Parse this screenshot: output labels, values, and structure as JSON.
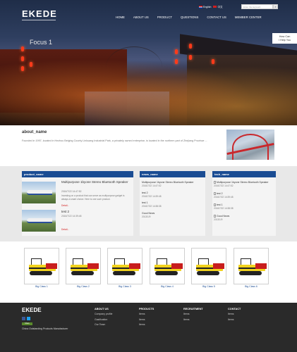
{
  "header": {
    "logo": "EKEDE",
    "lang_en": "English",
    "lang_cn": "中文",
    "search_placeholder": "Enter the keyword",
    "search_button": "⌕",
    "nav": [
      "HOME",
      "ABOUT US",
      "PRODUCT",
      "QUESTIONS",
      "CONTACT US",
      "MEMBER CENTER"
    ]
  },
  "hero": {
    "slide_label": "Focus 1",
    "help_line1": "How Can",
    "help_line2": "I Help You"
  },
  "about": {
    "title": "about_name",
    "text": "Founded in 1997, located in Hezhou Beiging County Linkuang Industrial Park, a privately owned enterprise, is located in the northern part of Zhejiang Province ..."
  },
  "products": {
    "head": "product_name",
    "items": [
      {
        "title": "Multipurpose 1byone Stereo Bluetooth Speaker",
        "date": "2016/7/22 14:47:52",
        "desc": "Investing on a product that can serve as multipurpose gadget is always a smart choice. Here is one such product.",
        "more": "Detail..."
      },
      {
        "title": "test 2",
        "date": "2016/7/22 14:39:48",
        "desc": "",
        "more": "Detail..."
      }
    ]
  },
  "news": {
    "head": "news_name",
    "items": [
      {
        "title": "Multipurpose 1byone Stereo Bluetooth Speaker",
        "date": "2016/7/22 14:47:52"
      },
      {
        "title": "test 2",
        "date": "2016/7/22 14:39:48"
      },
      {
        "title": "test 1",
        "date": "2016/7/22 14:38:38"
      },
      {
        "title": "Good News",
        "date": "2013/1/9"
      }
    ]
  },
  "tech": {
    "head": "tech_name",
    "items": [
      {
        "title": "Multipurpose 1byone Stereo Bluetooth Speaker",
        "date": "2016/7/22 14:47:52"
      },
      {
        "title": "test 2",
        "date": "2016/7/22 14:39:48"
      },
      {
        "title": "test 1",
        "date": "2016/7/22 14:38:38"
      },
      {
        "title": "Good News",
        "date": "2013/1/9"
      }
    ]
  },
  "gallery": [
    "Big Class 1",
    "Big Class 2",
    "Big Class 3",
    "Big Class 4",
    "Big Class 5",
    "Big Class 6"
  ],
  "footer": {
    "logo": "EKEDE",
    "share": "Share",
    "slogan": "China Outstanding Products Manufacturer",
    "cols": [
      {
        "head": "ABOUT US",
        "links": [
          "Company profile",
          "Gasification",
          "Our Team"
        ]
      },
      {
        "head": "PRODUCTS",
        "links": [
          "Items",
          "Items",
          "Items"
        ]
      },
      {
        "head": "RECRUITMENT",
        "links": [
          "Items",
          "Items"
        ]
      },
      {
        "head": "CONTACT",
        "links": [
          "Items",
          "Items"
        ]
      }
    ]
  },
  "colors": {
    "accent": "#1a4c93",
    "link_red": "#d21e1e",
    "footer_bg": "#2a2a2a"
  }
}
